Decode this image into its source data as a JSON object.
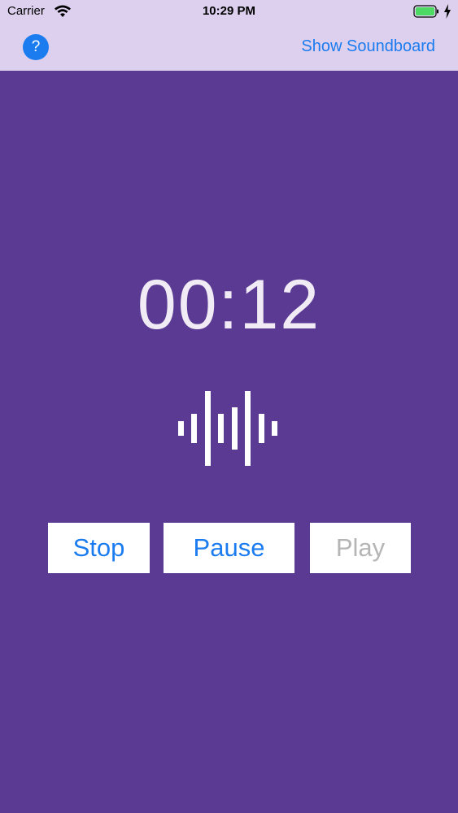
{
  "status_bar": {
    "carrier": "Carrier",
    "time": "10:29 PM"
  },
  "nav": {
    "help_label": "?",
    "show_soundboard_label": "Show Soundboard"
  },
  "timer": {
    "elapsed": "00:12"
  },
  "controls": {
    "stop_label": "Stop",
    "pause_label": "Pause",
    "play_label": "Play"
  },
  "colors": {
    "background": "#5b3a93",
    "nav_background": "#dcd0ee",
    "accent": "#1b7cf0",
    "disabled_text": "#b5b5b5",
    "battery": "#4cd964"
  }
}
